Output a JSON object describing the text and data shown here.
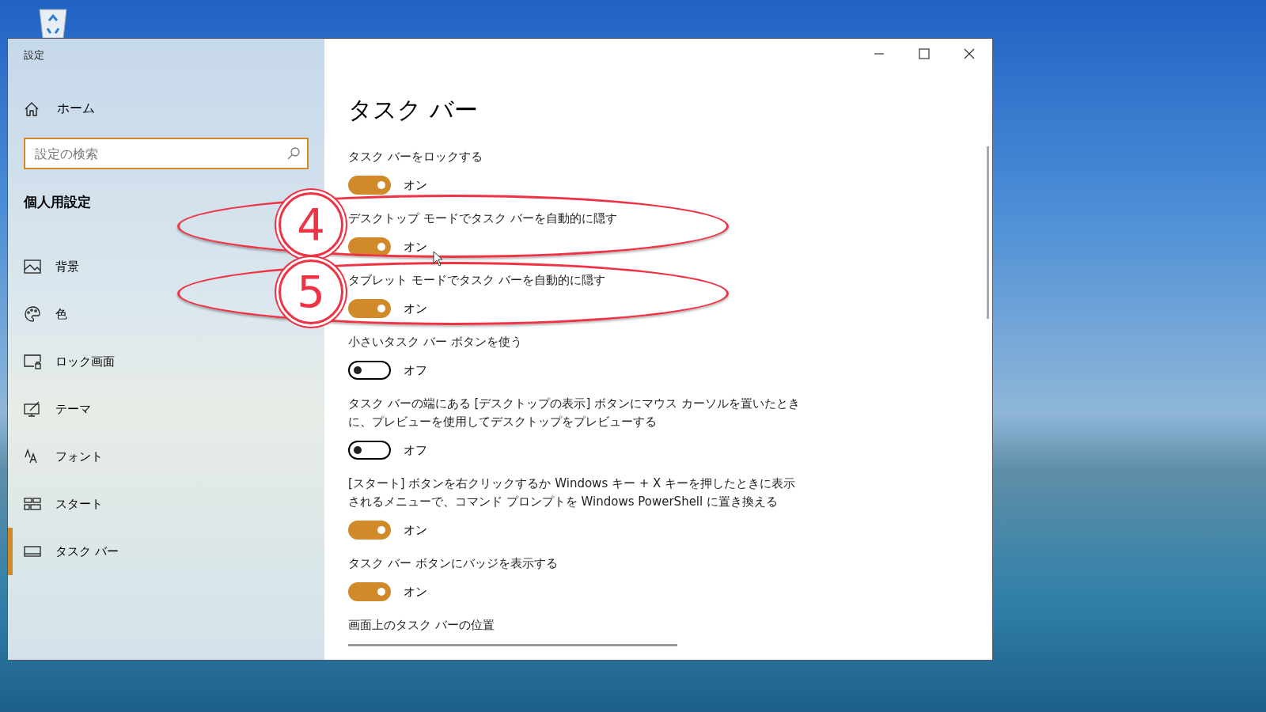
{
  "window": {
    "title": "設定"
  },
  "sidebar": {
    "home": "ホーム",
    "search": {
      "placeholder": "設定の検索"
    },
    "section": "個人用設定",
    "items": [
      {
        "label": "背景",
        "kind": "picture",
        "selected": false
      },
      {
        "label": "色",
        "kind": "palette",
        "selected": false
      },
      {
        "label": "ロック画面",
        "kind": "lockscreen",
        "selected": false
      },
      {
        "label": "テーマ",
        "kind": "theme",
        "selected": false
      },
      {
        "label": "フォント",
        "kind": "font",
        "selected": false
      },
      {
        "label": "スタート",
        "kind": "start",
        "selected": false
      },
      {
        "label": "タスク バー",
        "kind": "taskbar",
        "selected": true
      }
    ]
  },
  "page": {
    "title": "タスク バー",
    "settings": [
      {
        "label": "タスク バーをロックする",
        "on": true,
        "state": "オン"
      },
      {
        "label": "デスクトップ モードでタスク バーを自動的に隠す",
        "on": true,
        "state": "オン"
      },
      {
        "label": "タブレット モードでタスク バーを自動的に隠す",
        "on": true,
        "state": "オン"
      },
      {
        "label": "小さいタスク バー ボタンを使う",
        "on": false,
        "state": "オフ"
      },
      {
        "label": "タスク バーの端にある [デスクトップの表示] ボタンにマウス カーソルを置いたときに、プレビューを使用してデスクトップをプレビューする",
        "on": false,
        "state": "オフ"
      },
      {
        "label": "[スタート] ボタンを右クリックするか Windows キー + X キーを押したときに表示されるメニューで、コマンド プロンプトを Windows PowerShell に置き換える",
        "on": true,
        "state": "オン"
      },
      {
        "label": "タスク バー ボタンにバッジを表示する",
        "on": true,
        "state": "オン"
      }
    ],
    "last_label": "画面上のタスク バーの位置"
  },
  "annotations": [
    {
      "number": "4"
    },
    {
      "number": "5"
    }
  ]
}
